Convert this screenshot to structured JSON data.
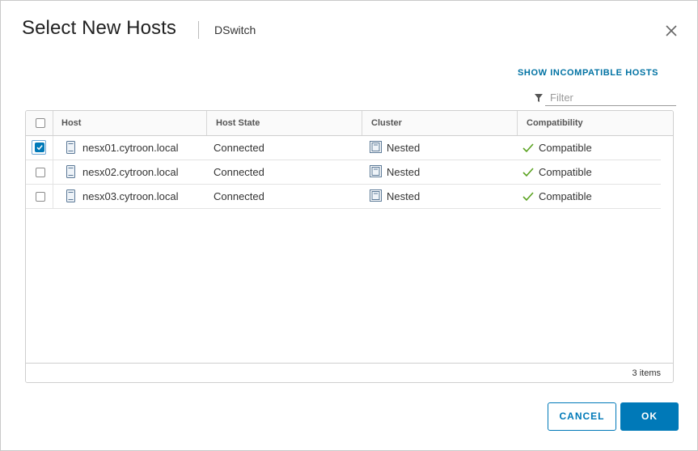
{
  "dialog": {
    "title": "Select New Hosts",
    "subtitle": "DSwitch"
  },
  "toolbar": {
    "show_incompatible_label": "SHOW INCOMPATIBLE HOSTS",
    "filter_placeholder": "Filter",
    "filter_value": ""
  },
  "grid": {
    "columns": [
      "Host",
      "Host State",
      "Cluster",
      "Compatibility"
    ],
    "select_all_checked": false,
    "rows": [
      {
        "selected": true,
        "host": "nesx01.cytroon.local",
        "state": "Connected",
        "cluster": "Nested",
        "compatibility": "Compatible"
      },
      {
        "selected": false,
        "host": "nesx02.cytroon.local",
        "state": "Connected",
        "cluster": "Nested",
        "compatibility": "Compatible"
      },
      {
        "selected": false,
        "host": "nesx03.cytroon.local",
        "state": "Connected",
        "cluster": "Nested",
        "compatibility": "Compatible"
      }
    ],
    "footer_count": "3 items"
  },
  "buttons": {
    "cancel_label": "CANCEL",
    "ok_label": "OK"
  },
  "icons": {
    "host": "server-icon",
    "cluster": "cluster-icon",
    "compatible": "check-icon",
    "filter": "filter-icon",
    "close": "close-icon"
  },
  "colors": {
    "accent": "#0079b8",
    "link": "#0072a3",
    "check": "#5aa220"
  }
}
